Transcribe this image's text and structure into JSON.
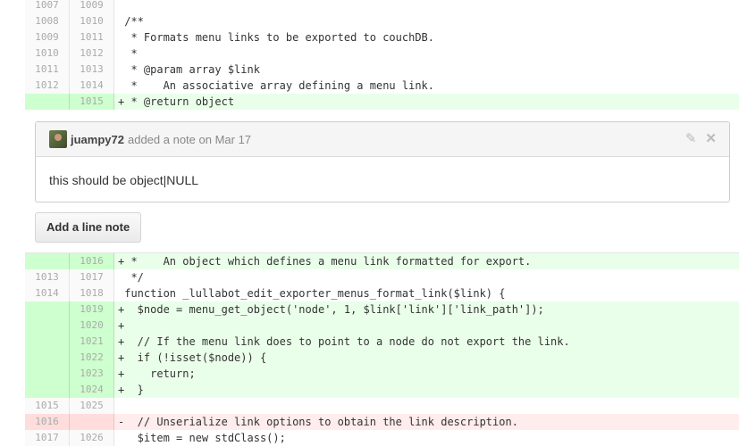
{
  "top_lines": [
    {
      "type": "ctx",
      "old": "1007",
      "new": "1009",
      "code": ""
    },
    {
      "type": "ctx",
      "old": "1008",
      "new": "1010",
      "code": " /**"
    },
    {
      "type": "ctx",
      "old": "1009",
      "new": "1011",
      "code": "  * Formats menu links to be exported to couchDB."
    },
    {
      "type": "ctx",
      "old": "1010",
      "new": "1012",
      "code": "  *"
    },
    {
      "type": "ctx",
      "old": "1011",
      "new": "1013",
      "code": "  * @param array $link"
    },
    {
      "type": "ctx",
      "old": "1012",
      "new": "1014",
      "code": "  *    An associative array defining a menu link."
    },
    {
      "type": "add",
      "old": "",
      "new": "1015",
      "code": "+ * @return object"
    }
  ],
  "comment": {
    "author": "juampy72",
    "action": "added a note on Mar 17",
    "body": "this should be object|NULL",
    "edit_icon": "pencil-icon",
    "close_icon": "close-icon"
  },
  "add_note_label": "Add a line note",
  "bottom_lines": [
    {
      "type": "add",
      "old": "",
      "new": "1016",
      "code": "+ *    An object which defines a menu link formatted for export."
    },
    {
      "type": "ctx",
      "old": "1013",
      "new": "1017",
      "code": "  */"
    },
    {
      "type": "ctx",
      "old": "1014",
      "new": "1018",
      "code": " function _lullabot_edit_exporter_menus_format_link($link) {"
    },
    {
      "type": "add",
      "old": "",
      "new": "1019",
      "code": "+  $node = menu_get_object('node', 1, $link['link']['link_path']);"
    },
    {
      "type": "add",
      "old": "",
      "new": "1020",
      "code": "+"
    },
    {
      "type": "add",
      "old": "",
      "new": "1021",
      "code": "+  // If the menu link does to point to a node do not export the link."
    },
    {
      "type": "add",
      "old": "",
      "new": "1022",
      "code": "+  if (!isset($node)) {"
    },
    {
      "type": "add",
      "old": "",
      "new": "1023",
      "code": "+    return;"
    },
    {
      "type": "add",
      "old": "",
      "new": "1024",
      "code": "+  }"
    },
    {
      "type": "ctx",
      "old": "1015",
      "new": "1025",
      "code": ""
    },
    {
      "type": "del",
      "old": "1016",
      "new": "",
      "code": "-  // Unserialize link options to obtain the link description."
    },
    {
      "type": "ctx",
      "old": "1017",
      "new": "1026",
      "code": "   $item = new stdClass();"
    }
  ]
}
